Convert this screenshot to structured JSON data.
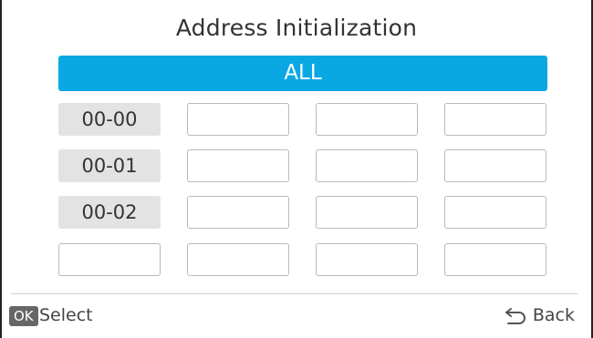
{
  "title": "Address Initialization",
  "all_label": "ALL",
  "addresses": [
    "00-00",
    "00-01",
    "00-02"
  ],
  "footer": {
    "ok_key": "OK",
    "select_label": "Select",
    "back_icon": "back-arrow-icon",
    "back_label": "Back"
  },
  "colors": {
    "accent": "#0aa8e2",
    "address_bg": "#e3e3e3",
    "cell_border": "#b9b9b9"
  }
}
